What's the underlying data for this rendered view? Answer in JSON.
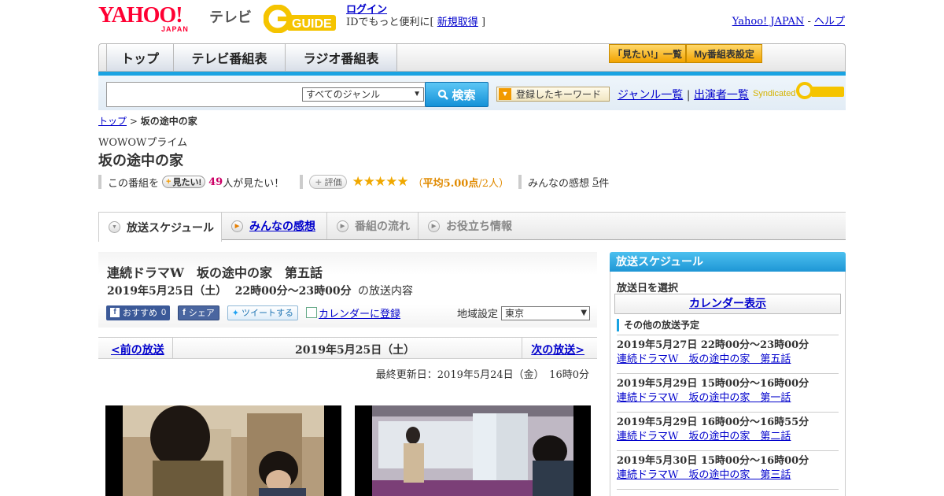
{
  "header": {
    "yahoo_logo": "YAHOO!",
    "yahoo_logo_sub": "JAPAN",
    "tv_label": "テレビ",
    "gguide_logo": "G-GUIDE",
    "login_link": "ログイン",
    "login_text": "IDでもっと便利に[",
    "register_link": "新規取得",
    "login_text_end": " ]",
    "yahoo_japan_link": "Yahoo! JAPAN",
    "help_sep": " - ",
    "help_link": "ヘルプ"
  },
  "nav": {
    "tabs": [
      {
        "label": "トップ"
      },
      {
        "label": "テレビ番組表"
      },
      {
        "label": "ラジオ番組表"
      }
    ],
    "mitai_list": "「見たい!」一覧",
    "my_schedule": "My番組表設定"
  },
  "search": {
    "input_value": "",
    "genre_selected": "すべてのジャンル",
    "search_button": "検索",
    "keyword_button": "登録したキーワード",
    "genre_list_link": "ジャンル一覧",
    "link_sep": " | ",
    "performer_list_link": "出演者一覧",
    "syndicated": "Syndicated"
  },
  "breadcrumb": {
    "top": "トップ",
    "sep": " > ",
    "current": "坂の途中の家"
  },
  "program": {
    "channel": "WOWOWプライム",
    "title": "坂の途中の家",
    "this_program": "この番組を",
    "mitai_button": "見たい!",
    "mitai_count": "49",
    "mitai_suffix": "人が見たい！",
    "eval_button": "評価",
    "stars": "★★★★★",
    "avg_open": "（",
    "avg_label": "平均5.00点",
    "avg_people": "/2人）",
    "impressions_label": "みんなの感想",
    "impressions_count": "5",
    "impressions_unit": "件"
  },
  "subtabs": [
    {
      "label": "放送スケジュール"
    },
    {
      "label": "みんなの感想"
    },
    {
      "label": "番組の流れ"
    },
    {
      "label": "お役立ち情報"
    }
  ],
  "episode": {
    "title": "連続ドラマW　坂の途中の家　第五話",
    "date": "2019年5月25日（土）",
    "time": "22時00分～23時00分",
    "suffix": "の放送内容",
    "fb_recommend": "おすすめ",
    "fb_recommend_count": "0",
    "fb_share": "シェア",
    "tweet": "ツイートする",
    "calendar_register": "カレンダーに登録",
    "region_label": "地域設定",
    "region_value": "東京"
  },
  "datenav": {
    "prev": "<前の放送",
    "current": "2019年5月25日（土）",
    "next": "次の放送>"
  },
  "updated": "最終更新日：2019年5月24日（金）　16時0分",
  "sidebar": {
    "header": "放送スケジュール",
    "select_date": "放送日を選択",
    "calendar_button": "カレンダー表示",
    "other_header": "その他の放送予定",
    "schedules": [
      {
        "date": "2019年5月27日  22時00分～23時00分",
        "title": "連続ドラマW　坂の途中の家　第五話"
      },
      {
        "date": "2019年5月29日  15時00分～16時00分",
        "title": "連続ドラマW　坂の途中の家　第一話"
      },
      {
        "date": "2019年5月29日  16時00分～16時55分",
        "title": "連続ドラマW　坂の途中の家　第二話"
      },
      {
        "date": "2019年5月30日  15時00分～16時00分",
        "title": "連続ドラマW　坂の途中の家　第三話"
      }
    ]
  },
  "colors": {
    "accent_blue": "#1aa3e2",
    "yahoo_red": "#ff0033",
    "star_orange": "#f0a800",
    "link": "#0000cc"
  }
}
